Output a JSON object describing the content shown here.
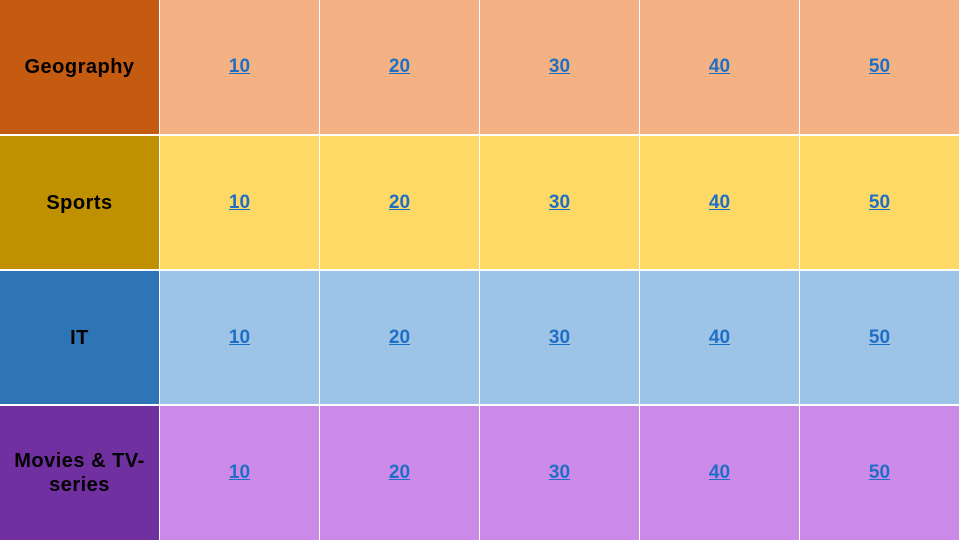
{
  "categories": [
    {
      "name": "Geography",
      "header_color": "#c55a11",
      "cell_color": "#f4b183",
      "values": [
        "10",
        "20",
        "30",
        "40",
        "50"
      ]
    },
    {
      "name": "Sports",
      "header_color": "#bf9000",
      "cell_color": "#ffd966",
      "values": [
        "10",
        "20",
        "30",
        "40",
        "50"
      ]
    },
    {
      "name": "IT",
      "header_color": "#2e75b6",
      "cell_color": "#9dc3e6",
      "values": [
        "10",
        "20",
        "30",
        "40",
        "50"
      ]
    },
    {
      "name": "Movies & TV-series",
      "header_color": "#7030a0",
      "cell_color": "#cc8ae8",
      "values": [
        "10",
        "20",
        "30",
        "40",
        "50"
      ]
    }
  ],
  "link_color": "#1f6fc6"
}
